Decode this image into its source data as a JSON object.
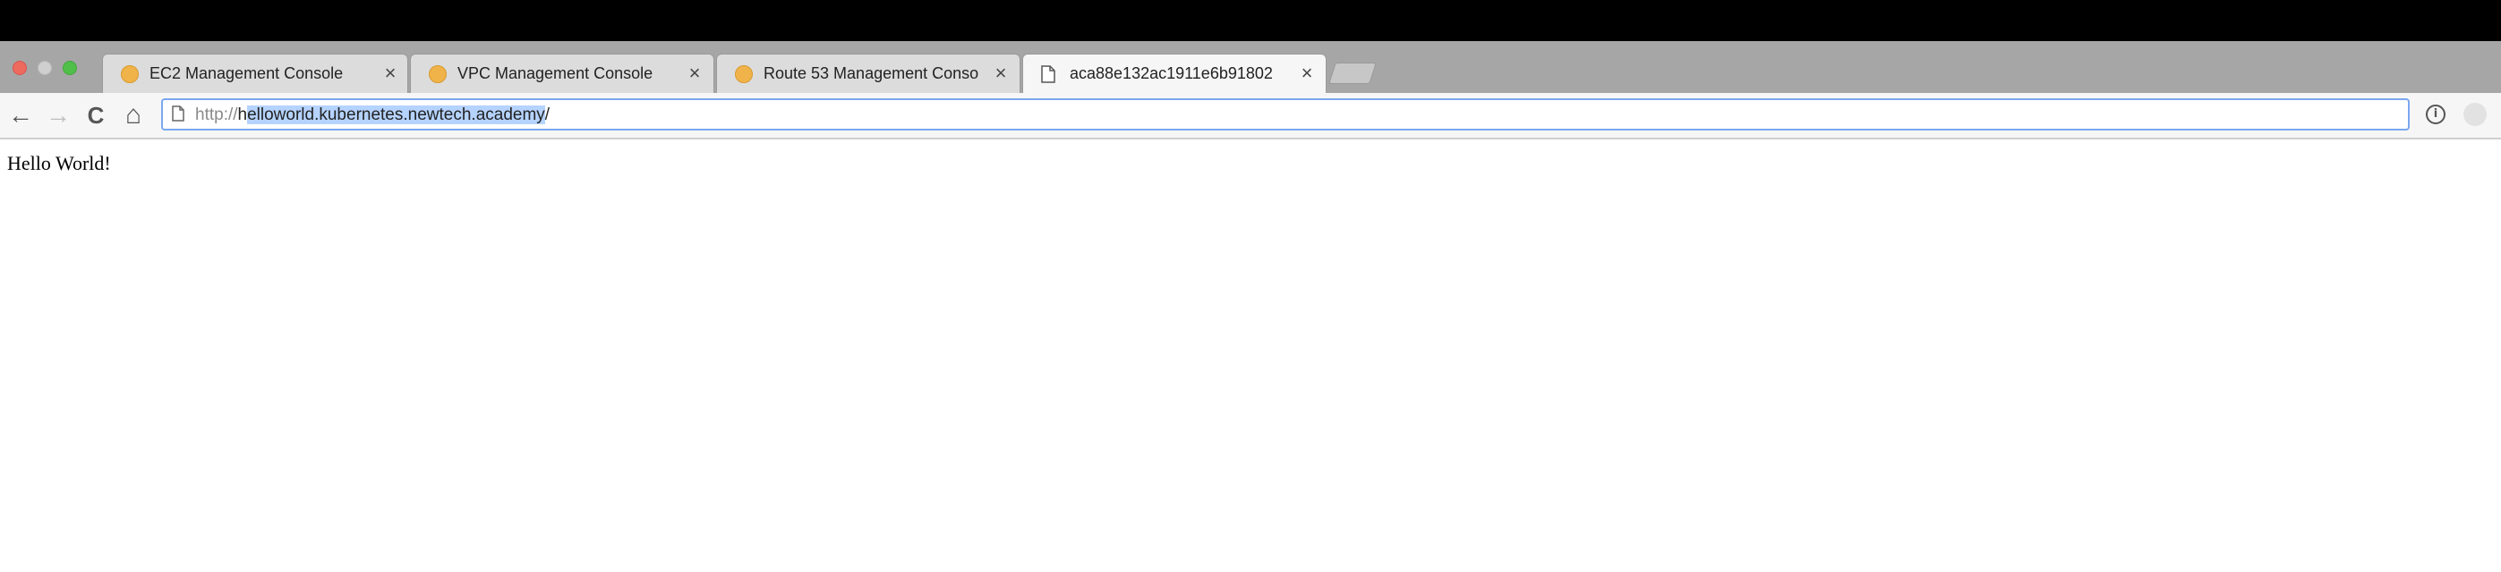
{
  "browser": {
    "tabs": [
      {
        "title": "EC2 Management Console",
        "favicon": "aws-console-icon"
      },
      {
        "title": "VPC Management Console",
        "favicon": "aws-console-icon"
      },
      {
        "title": "Route 53 Management Conso",
        "favicon": "aws-console-icon"
      },
      {
        "title": "aca88e132ac1911e6b91802",
        "favicon": "page-icon"
      }
    ],
    "close_glyph": "×",
    "address_bar": {
      "scheme": "http://",
      "host_first_char": "h",
      "host_rest": "elloworld.kubernetes.newtech.academy",
      "cursor": "/"
    },
    "nav_icons": {
      "back": "←",
      "forward": "→",
      "reload": "C",
      "home": "⌂"
    },
    "info_glyph": "i"
  },
  "page": {
    "body_text": "Hello World!"
  },
  "colors": {
    "selection": "#b5d3ff",
    "omnibox_focus": "#7aa7ef",
    "tab_strip": "#a6a6a6"
  }
}
